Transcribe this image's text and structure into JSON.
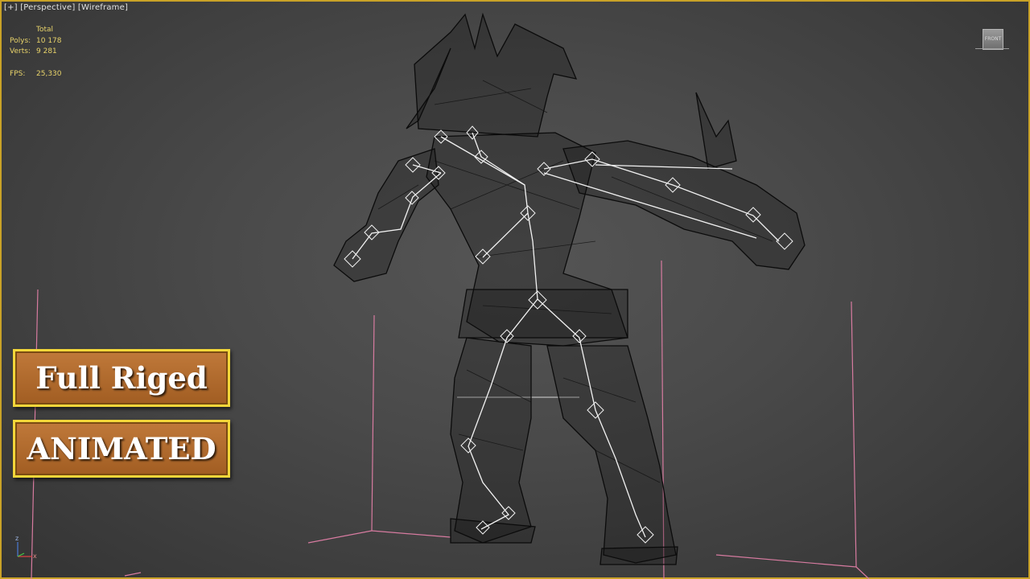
{
  "viewport": {
    "label_plus": "[+]",
    "label_view": "[Perspective]",
    "label_shading": "[Wireframe]"
  },
  "stats": {
    "header": "Total",
    "polys_label": "Polys:",
    "polys_value": "10 178",
    "verts_label": "Verts:",
    "verts_value": "9 281",
    "fps_label": "FPS:",
    "fps_value": "25,330"
  },
  "viewcube": {
    "face_label": "FRONT"
  },
  "axis_gizmo": {
    "z_label": "z",
    "x_label": "x"
  },
  "badges": {
    "rigged": "Full Riged",
    "animated": "ANIMATED"
  },
  "colors": {
    "viewport_border": "#c9a227",
    "stats_text": "#e8d36a",
    "grid_lines": "#d77ba0",
    "wireframe": "#0b0b0b",
    "bones": "#f2f2f2",
    "badge_border": "#f2d63a",
    "badge_fill": "#b06a2c"
  }
}
